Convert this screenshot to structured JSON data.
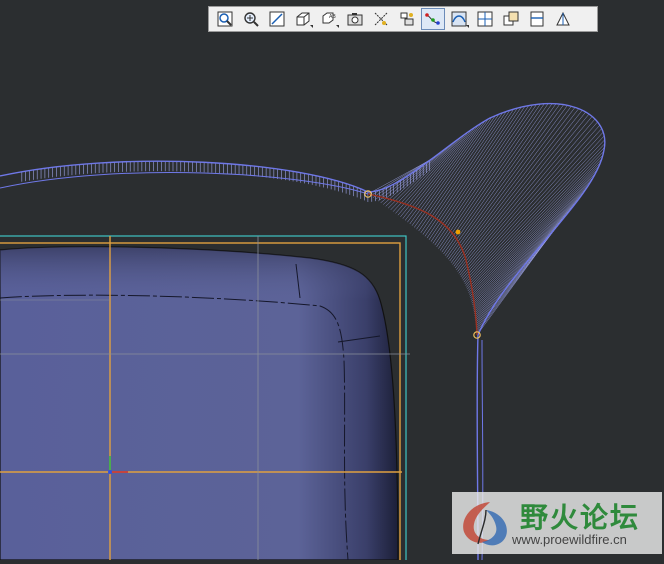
{
  "toolbar": {
    "items": [
      {
        "name": "refit-icon"
      },
      {
        "name": "zoom-in-icon"
      },
      {
        "name": "zoom-window-icon"
      },
      {
        "name": "orient-view-icon",
        "dropdown": true
      },
      {
        "name": "saved-views-icon",
        "dropdown": true
      },
      {
        "name": "snapshot-icon"
      },
      {
        "name": "axis-display-icon"
      },
      {
        "name": "datum-display-icon"
      },
      {
        "name": "control-points-icon",
        "active": true
      },
      {
        "name": "curvature-display-icon",
        "dropdown": true
      },
      {
        "name": "plane-view-icon"
      },
      {
        "name": "copy-view-icon"
      },
      {
        "name": "split-view-icon"
      },
      {
        "name": "section-view-icon"
      }
    ]
  },
  "watermark": {
    "title": "野火论坛",
    "url": "www.proewildfire.cn"
  },
  "colors": {
    "background": "#2b2e30",
    "surface": "#5a6296",
    "curve": "#6f78e8",
    "porcupine": "#a0a6ec",
    "datum_orange": "#e0a040",
    "datum_cyan": "#3fc4c4",
    "control_point": "#f0a000",
    "spline": "#9a3020"
  }
}
